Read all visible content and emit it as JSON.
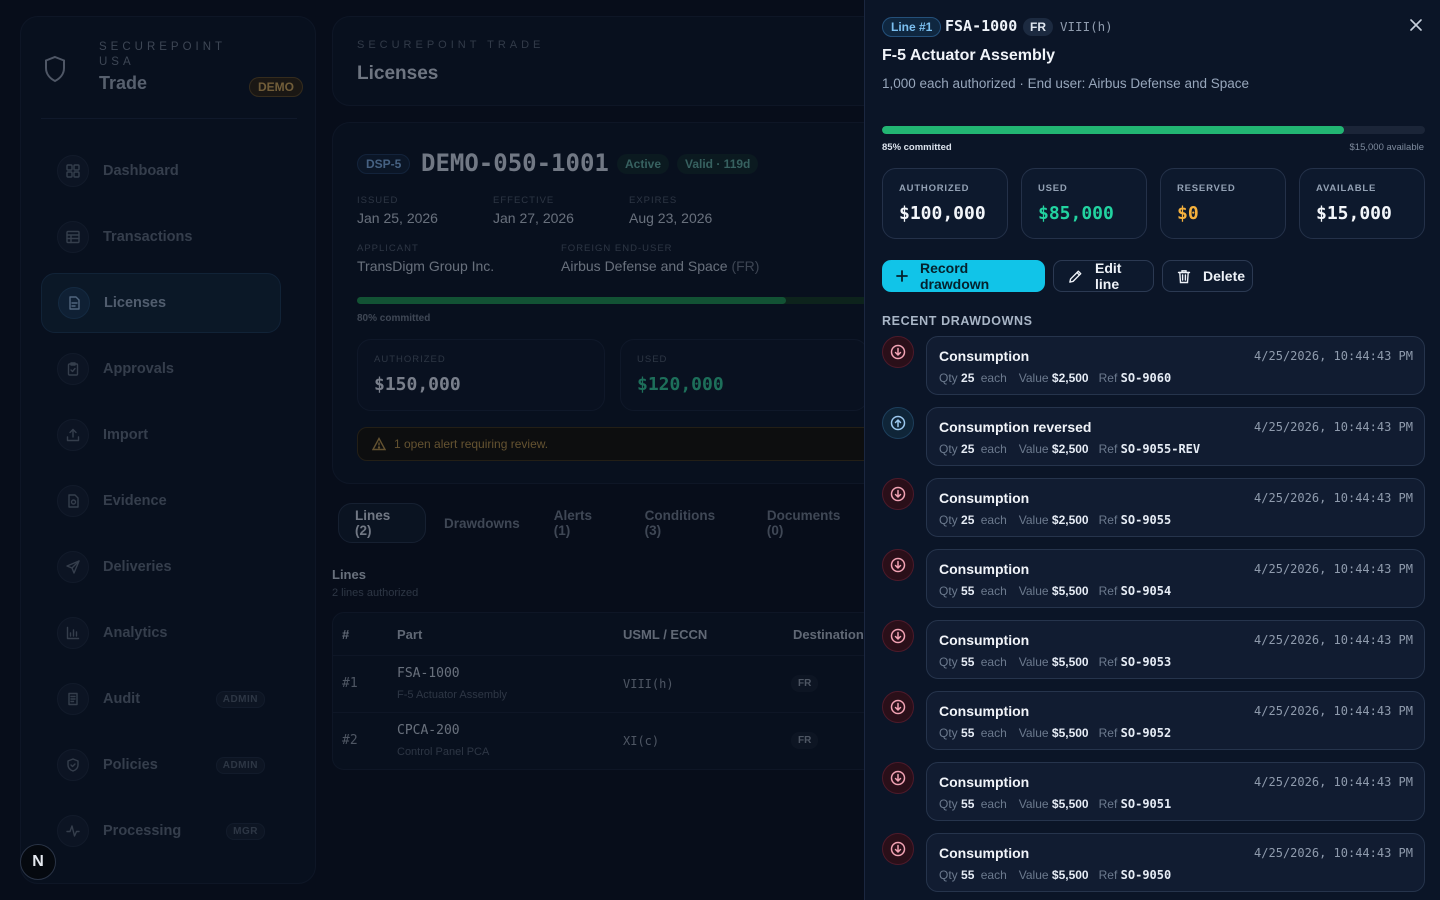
{
  "brand": {
    "line1": "SECUREPOINT",
    "line2": "USA",
    "name": "Trade",
    "badge": "DEMO"
  },
  "nav": [
    {
      "label": "Dashboard",
      "icon": "dashboard-icon"
    },
    {
      "label": "Transactions",
      "icon": "transactions-icon"
    },
    {
      "label": "Licenses",
      "icon": "licenses-icon",
      "active": true
    },
    {
      "label": "Approvals",
      "icon": "approvals-icon"
    },
    {
      "label": "Import",
      "icon": "import-icon"
    },
    {
      "label": "Evidence",
      "icon": "evidence-icon"
    },
    {
      "label": "Deliveries",
      "icon": "deliveries-icon"
    },
    {
      "label": "Analytics",
      "icon": "analytics-icon"
    },
    {
      "label": "Audit",
      "icon": "audit-icon",
      "tag": "ADMIN"
    },
    {
      "label": "Policies",
      "icon": "policies-icon",
      "tag": "ADMIN"
    },
    {
      "label": "Processing",
      "icon": "processing-icon",
      "tag": "MGR"
    }
  ],
  "n_button": "N",
  "header": {
    "kicker": "SECUREPOINT TRADE",
    "title": "Licenses"
  },
  "license": {
    "type": "DSP-5",
    "number": "DEMO-050-1001",
    "status": "Active",
    "validity": "Valid · 119d",
    "issued_label": "ISSUED",
    "issued": "Jan 25, 2026",
    "effective_label": "EFFECTIVE",
    "effective": "Jan 27, 2026",
    "expires_label": "EXPIRES",
    "expires": "Aug 23, 2026",
    "applicant_label": "APPLICANT",
    "applicant": "TransDigm Group Inc.",
    "enduser_label": "FOREIGN END-USER",
    "enduser": "Airbus Defense and Space",
    "enduser_country": "(FR)",
    "committed_pct": 80,
    "committed_text": "80% committed",
    "authorized_label": "AUTHORIZED",
    "authorized": "$150,000",
    "used_label": "USED",
    "used": "$120,000",
    "alert": "1 open alert requiring review."
  },
  "tabs": [
    "Lines (2)",
    "Drawdowns",
    "Alerts (1)",
    "Conditions (3)",
    "Documents (0)"
  ],
  "lines": {
    "title": "Lines",
    "subtitle": "2 lines authorized",
    "headers": [
      "#",
      "Part",
      "USML / ECCN",
      "Destination"
    ],
    "rows": [
      {
        "num": "#1",
        "part": "FSA-1000",
        "desc": "F-5 Actuator Assembly",
        "usml": "VIII(h)",
        "dest": "FR"
      },
      {
        "num": "#2",
        "part": "CPCA-200",
        "desc": "Control Panel PCA",
        "usml": "XI(c)",
        "dest": "FR"
      }
    ]
  },
  "drawer": {
    "line_badge": "Line #1",
    "part": "FSA-1000",
    "country": "FR",
    "usml": "VIII(h)",
    "title": "F-5 Actuator Assembly",
    "subtitle": "1,000 each authorized · End user: Airbus Defense and Space",
    "committed_pct": 85,
    "committed_text": "85% committed",
    "available_text": "$15,000 available",
    "stats": {
      "authorized_label": "AUTHORIZED",
      "authorized": "$100,000",
      "used_label": "USED",
      "used": "$85,000",
      "reserved_label": "RESERVED",
      "reserved": "$0",
      "available_label": "AVAILABLE",
      "available": "$15,000"
    },
    "buttons": {
      "record": "Record drawdown",
      "edit": "Edit line",
      "delete": "Delete"
    },
    "recent_heading": "RECENT DRAWDOWNS",
    "meta_labels": {
      "qty": "Qty",
      "unit": "each",
      "value": "Value",
      "ref": "Ref"
    },
    "drawdowns": [
      {
        "kind": "down",
        "title": "Consumption",
        "time": "4/25/2026, 10:44:43 PM",
        "qty": "25",
        "value": "$2,500",
        "ref": "SO-9060"
      },
      {
        "kind": "up",
        "title": "Consumption reversed",
        "time": "4/25/2026, 10:44:43 PM",
        "qty": "25",
        "value": "$2,500",
        "ref": "SO-9055-REV"
      },
      {
        "kind": "down",
        "title": "Consumption",
        "time": "4/25/2026, 10:44:43 PM",
        "qty": "25",
        "value": "$2,500",
        "ref": "SO-9055"
      },
      {
        "kind": "down",
        "title": "Consumption",
        "time": "4/25/2026, 10:44:43 PM",
        "qty": "55",
        "value": "$5,500",
        "ref": "SO-9054"
      },
      {
        "kind": "down",
        "title": "Consumption",
        "time": "4/25/2026, 10:44:43 PM",
        "qty": "55",
        "value": "$5,500",
        "ref": "SO-9053"
      },
      {
        "kind": "down",
        "title": "Consumption",
        "time": "4/25/2026, 10:44:43 PM",
        "qty": "55",
        "value": "$5,500",
        "ref": "SO-9052"
      },
      {
        "kind": "down",
        "title": "Consumption",
        "time": "4/25/2026, 10:44:43 PM",
        "qty": "55",
        "value": "$5,500",
        "ref": "SO-9051"
      },
      {
        "kind": "down",
        "title": "Consumption",
        "time": "4/25/2026, 10:44:43 PM",
        "qty": "55",
        "value": "$5,500",
        "ref": "SO-9050"
      }
    ]
  },
  "colors": {
    "accent": "#11c4e8",
    "used": "#22d3a0",
    "reserved": "#f5b13d",
    "progress": "#22b573",
    "danger": "#e0526e"
  }
}
